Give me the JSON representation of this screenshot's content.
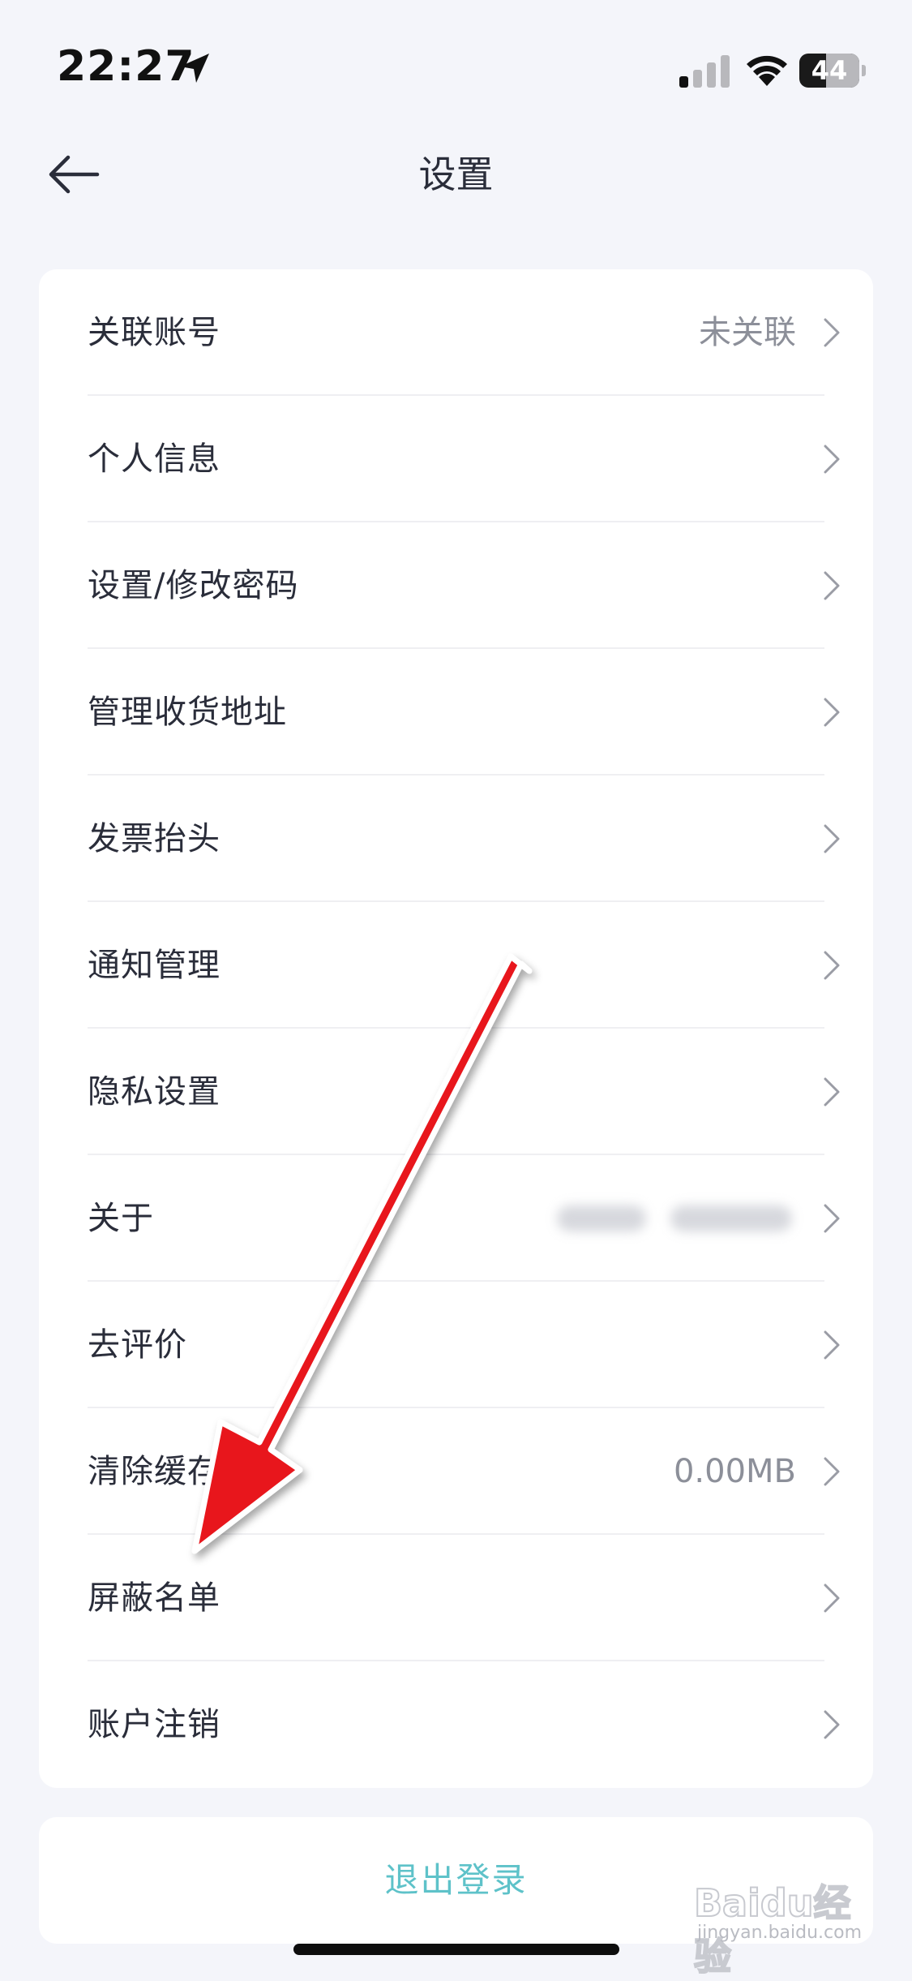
{
  "status_bar": {
    "time": "22:27",
    "battery": "44",
    "battery_level": 0.44
  },
  "header": {
    "title": "设置"
  },
  "settings": {
    "items": [
      {
        "label": "关联账号",
        "value": "未关联"
      },
      {
        "label": "个人信息",
        "value": ""
      },
      {
        "label": "设置/修改密码",
        "value": ""
      },
      {
        "label": "管理收货地址",
        "value": ""
      },
      {
        "label": "发票抬头",
        "value": ""
      },
      {
        "label": "通知管理",
        "value": ""
      },
      {
        "label": "隐私设置",
        "value": ""
      },
      {
        "label": "关于",
        "value": ""
      },
      {
        "label": "去评价",
        "value": ""
      },
      {
        "label": "清除缓存",
        "value": "0.00MB"
      },
      {
        "label": "屏蔽名单",
        "value": ""
      },
      {
        "label": "账户注销",
        "value": ""
      }
    ]
  },
  "logout": {
    "label": "退出登录"
  },
  "watermark": {
    "brand": "Baidu经验",
    "sub": "jingyan.baidu.com"
  },
  "colors": {
    "background": "#f4f5fa",
    "card": "#ffffff",
    "accent": "#5ec2c9",
    "arrow": "#e8141c",
    "text": "#2a2d3a",
    "secondary_text": "#8c8f99"
  }
}
